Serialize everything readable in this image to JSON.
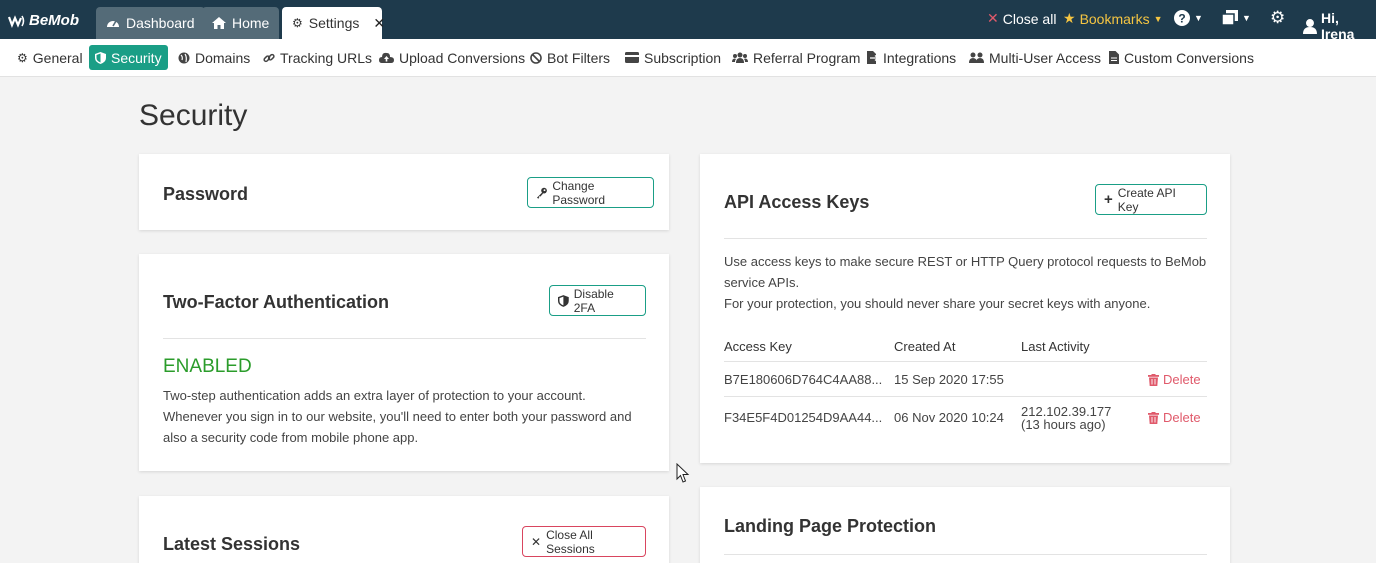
{
  "colors": {
    "topbar": "#1e3a4c",
    "accent": "#1a9e86",
    "danger": "#e05a6b",
    "enabled": "#2b9c2b",
    "bookmarks": "#f5c542"
  },
  "logo": {
    "text": "BeMob"
  },
  "tabs": [
    {
      "label": "Dashboard",
      "icon": "dashboard-icon"
    },
    {
      "label": "Home",
      "icon": "home-icon"
    },
    {
      "label": "Settings",
      "icon": "gear-icon",
      "close": "✕"
    }
  ],
  "topright": {
    "close_all": "Close all",
    "bookmarks": "Bookmarks",
    "greeting": "Hi, Irena"
  },
  "subnav": [
    {
      "label": "General",
      "icon": "gear-icon"
    },
    {
      "label": "Security",
      "icon": "shield-icon"
    },
    {
      "label": "Domains",
      "icon": "globe-icon"
    },
    {
      "label": "Tracking URLs",
      "icon": "link-icon"
    },
    {
      "label": "Upload Conversions",
      "icon": "cloud-upload-icon"
    },
    {
      "label": "Bot Filters",
      "icon": "ban-icon"
    },
    {
      "label": "Subscription",
      "icon": "credit-card-icon"
    },
    {
      "label": "Referral Program",
      "icon": "users-icon"
    },
    {
      "label": "Integrations",
      "icon": "file-export-icon"
    },
    {
      "label": "Multi-User Access",
      "icon": "user-group-icon"
    },
    {
      "label": "Custom Conversions",
      "icon": "file-icon"
    }
  ],
  "page": {
    "title": "Security"
  },
  "password": {
    "title": "Password",
    "button": "Change Password"
  },
  "twofa": {
    "title": "Two-Factor Authentication",
    "button": "Disable 2FA",
    "status": "ENABLED",
    "lines": [
      "Two-step authentication adds an extra layer of protection to your account.",
      "Whenever you sign in to our website, you'll need to enter both your password and",
      "also a security code from mobile phone app."
    ]
  },
  "sessions": {
    "title": "Latest Sessions",
    "button": "Close All Sessions"
  },
  "api": {
    "title": "API Access Keys",
    "button": "Create API Key",
    "desc": [
      "Use access keys to make secure REST or HTTP Query protocol requests to BeMob",
      "service APIs.",
      "For your protection, you should never share your secret keys with anyone."
    ],
    "headers": [
      "Access Key",
      "Created At",
      "Last Activity"
    ],
    "rows": [
      {
        "key": "B7E180606D764C4AA88...",
        "created": "15 Sep 2020 17:55",
        "activity": "",
        "activity_sub": "",
        "action": "Delete"
      },
      {
        "key": "F34E5F4D01254D9AA44...",
        "created": "06 Nov 2020 10:24",
        "activity": "212.102.39.177",
        "activity_sub": "(13 hours ago)",
        "action": "Delete"
      }
    ]
  },
  "landing": {
    "title": "Landing Page Protection"
  }
}
